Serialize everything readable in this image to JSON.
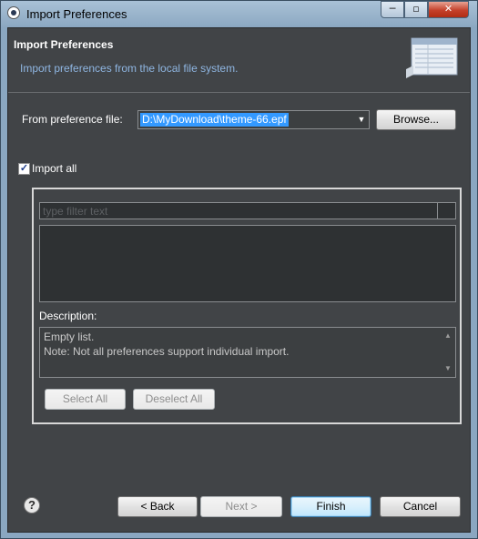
{
  "window": {
    "title": "Import Preferences",
    "controls": {
      "minimize": "─",
      "maximize": "▫",
      "close": "✕"
    }
  },
  "header": {
    "title": "Import Preferences",
    "description": "Import preferences from the local file system."
  },
  "file": {
    "label": "From preference file:",
    "value": "D:\\MyDownload\\theme-66.epf",
    "dropdown_icon": "▼",
    "browse_label": "Browse..."
  },
  "import_all": {
    "label": "Import all",
    "checked": true,
    "check_glyph": "✓"
  },
  "filter": {
    "placeholder": "type filter text"
  },
  "description": {
    "label": "Description:",
    "lines": [
      "Empty list.",
      "Note: Not all preferences support individual import."
    ]
  },
  "selection": {
    "select_all": "Select All",
    "deselect_all": "Deselect All"
  },
  "footer": {
    "help_icon": "?",
    "back": "< Back",
    "next": "Next >",
    "finish": "Finish",
    "cancel": "Cancel"
  },
  "icons": {
    "scroll_up": "▲",
    "scroll_down": "▼"
  },
  "colors": {
    "client_bg": "#414447",
    "accent_text": "#8fb6e2",
    "selection": "#3399ff"
  }
}
